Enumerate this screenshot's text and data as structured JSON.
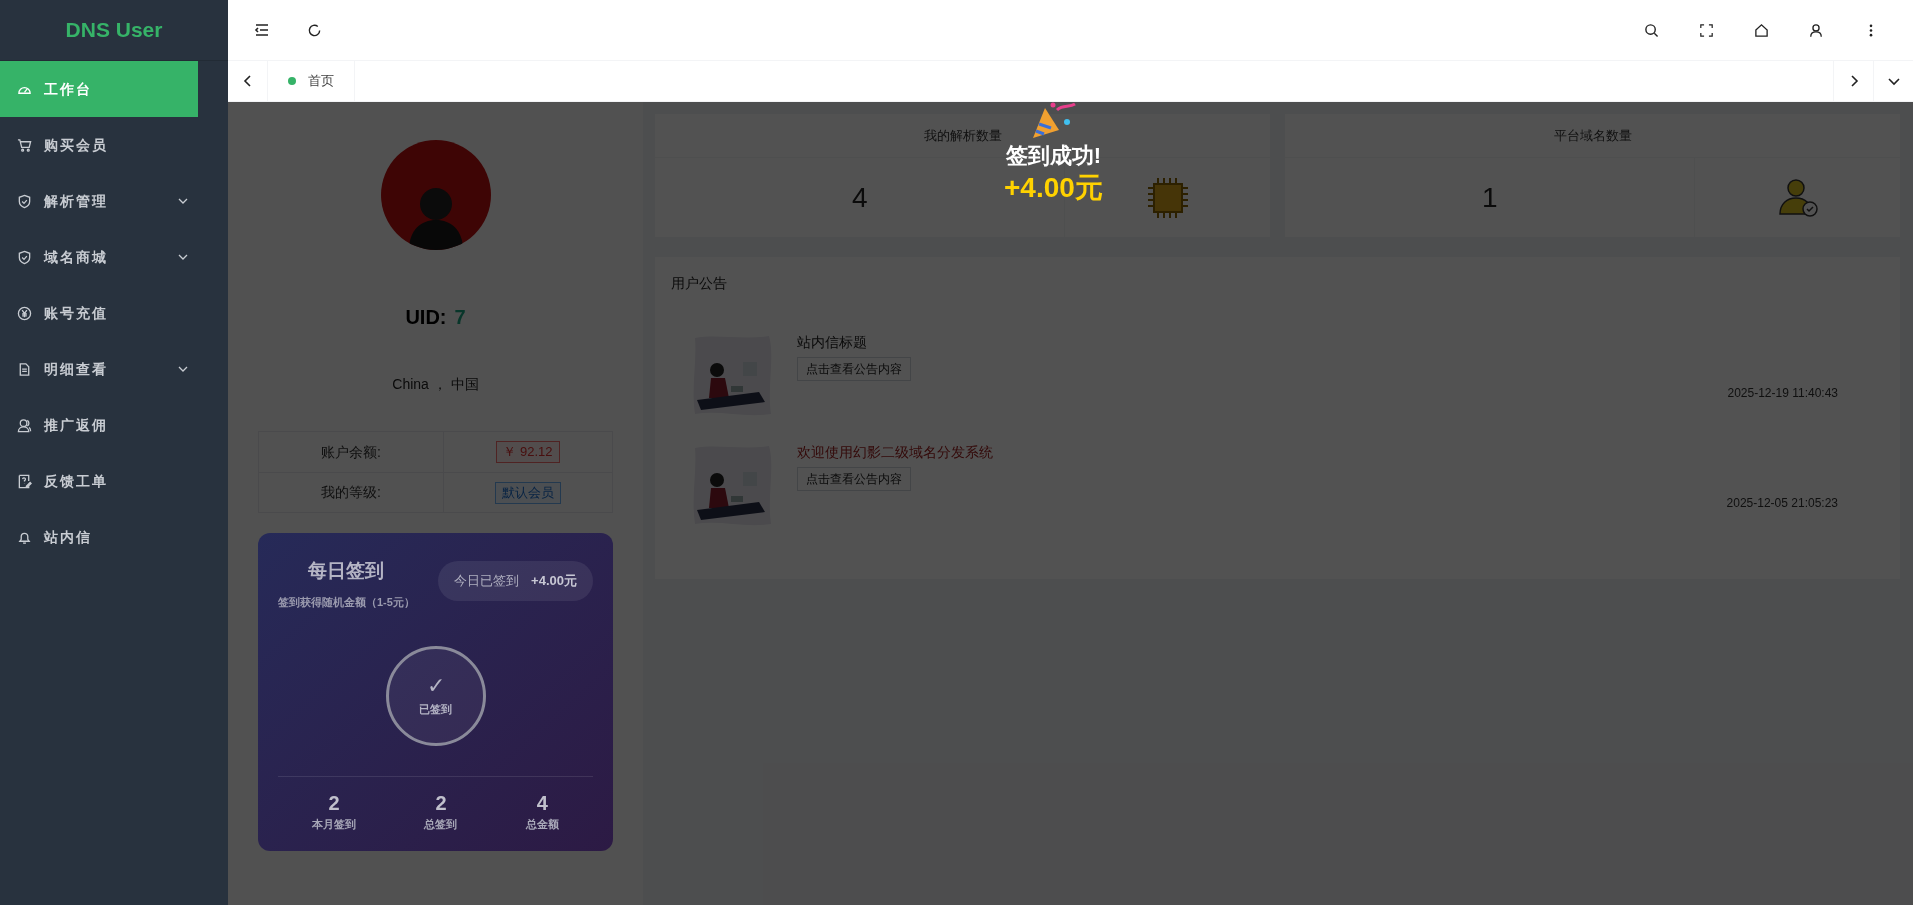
{
  "sidebar": {
    "logo": "DNS User",
    "items": [
      {
        "label": "工作台",
        "selected": true,
        "expandable": false
      },
      {
        "label": "购买会员",
        "selected": false,
        "expandable": false
      },
      {
        "label": "解析管理",
        "selected": false,
        "expandable": true
      },
      {
        "label": "域名商城",
        "selected": false,
        "expandable": true
      },
      {
        "label": "账号充值",
        "selected": false,
        "expandable": false
      },
      {
        "label": "明细查看",
        "selected": false,
        "expandable": true
      },
      {
        "label": "推广返佣",
        "selected": false,
        "expandable": false
      },
      {
        "label": "反馈工单",
        "selected": false,
        "expandable": false
      },
      {
        "label": "站内信",
        "selected": false,
        "expandable": false
      }
    ]
  },
  "tabs": [
    {
      "label": "首页",
      "selected": true
    }
  ],
  "profile": {
    "uid_label": "UID:",
    "uid": "7",
    "location": "China ， 中国",
    "rows": [
      {
        "label": "账户余额:",
        "value": "￥ 92.12",
        "kind": "money"
      },
      {
        "label": "我的等级:",
        "value": "默认会员",
        "kind": "level"
      }
    ]
  },
  "checkin": {
    "title": "每日签到",
    "subtitle": "签到获得随机金额（1-5元）",
    "status": "今日已签到",
    "amount": "+4.00元",
    "mark": "✓",
    "circle_label": "已签到",
    "stats": [
      {
        "value": "2",
        "label": "本月签到"
      },
      {
        "value": "2",
        "label": "总签到"
      },
      {
        "value": "4",
        "label": "总金额"
      }
    ]
  },
  "stats_cards": [
    {
      "title": "我的解析数量",
      "value": "4"
    },
    {
      "title": "平台域名数量",
      "value": "1"
    }
  ],
  "announcements": {
    "title": "用户公告",
    "items": [
      {
        "title": "站内信标题",
        "button": "点击查看公告内容",
        "time": "2025-12-19 11:40:43",
        "highlighted": false
      },
      {
        "title": "欢迎使用幻影二级域名分发系统",
        "button": "点击查看公告内容",
        "time": "2025-12-05 21:05:23",
        "highlighted": true
      }
    ]
  },
  "toast": {
    "title": "签到成功!",
    "amount": "+4.00元"
  }
}
